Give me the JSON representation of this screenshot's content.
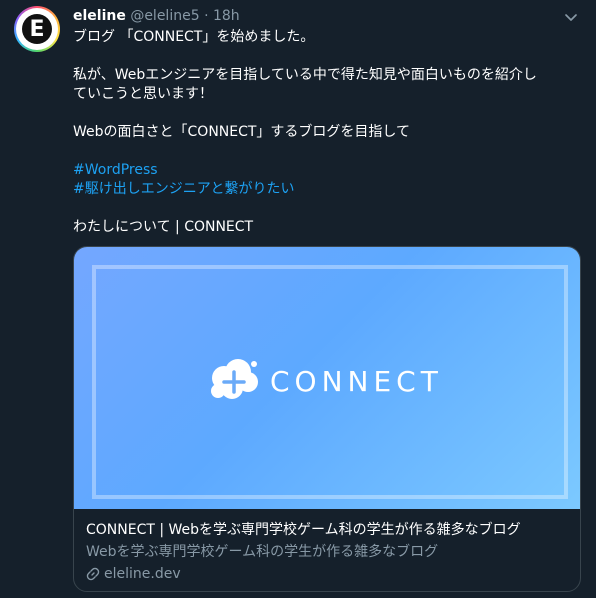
{
  "tweet": {
    "author_name": "eleline",
    "handle": "@eleline5",
    "separator": "·",
    "time": "18h",
    "avatar_letter": "E",
    "lines": [
      "ブログ 「CONNECT」を始めました。",
      "",
      "私が、Webエンジニアを目指している中で得た知見や面白いものを紹介し",
      "ていこうと思います！",
      "",
      "Webの面白さと「CONNECT」するブログを目指して"
    ],
    "hashtags": [
      "#WordPress",
      "#駆け出しエンジニアと繋がりたい"
    ],
    "link_text": "わたしについて | CONNECT"
  },
  "card": {
    "logo_text": "CONNECT",
    "title": "CONNECT | Webを学ぶ専門学校ゲーム科の学生が作る雑多なブログ",
    "description": "Webを学ぶ専門学校ゲーム科の学生が作る雑多なブログ",
    "domain": "eleline.dev"
  },
  "colors": {
    "background": "#15202b",
    "link": "#1da1f2",
    "muted": "#8899a6",
    "card_border": "#38444d"
  }
}
